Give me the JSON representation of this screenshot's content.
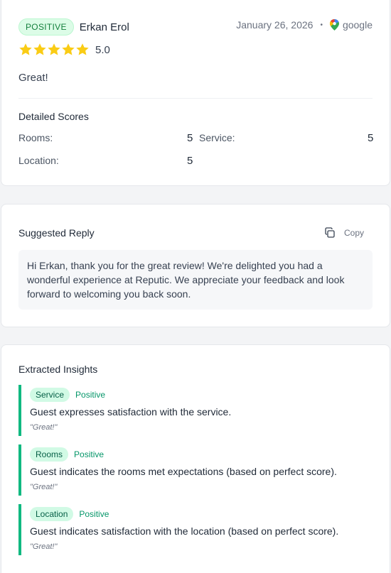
{
  "review": {
    "sentiment": "POSITIVE",
    "reviewer": "Erkan Erol",
    "date": "January 26, 2026",
    "separator": "•",
    "source": "google",
    "rating": "5.0",
    "stars": 5,
    "text": "Great!"
  },
  "scores": {
    "title": "Detailed Scores",
    "rooms_label": "Rooms:",
    "rooms_value": "5",
    "service_label": "Service:",
    "service_value": "5",
    "location_label": "Location:",
    "location_value": "5"
  },
  "reply": {
    "title": "Suggested Reply",
    "copy_label": "Copy",
    "text": "Hi Erkan, thank you for the great review! We're delighted you had a wonderful experience at Reputic. We appreciate your feedback and look forward to welcoming you back soon."
  },
  "insights": {
    "title": "Extracted Insights",
    "items": [
      {
        "category": "Service",
        "sentiment": "Positive",
        "text": "Guest expresses satisfaction with the service.",
        "quote": "\"Great!\""
      },
      {
        "category": "Rooms",
        "sentiment": "Positive",
        "text": "Guest indicates the rooms met expectations (based on perfect score).",
        "quote": "\"Great!\""
      },
      {
        "category": "Location",
        "sentiment": "Positive",
        "text": "Guest indicates satisfaction with the location (based on perfect score).",
        "quote": "\"Great!\""
      }
    ]
  },
  "colors": {
    "star": "#facc15",
    "accent": "#10b981",
    "badge_bg": "#dcfce7"
  },
  "icons": [
    "star-icon",
    "google-maps-pin-icon",
    "copy-icon"
  ]
}
